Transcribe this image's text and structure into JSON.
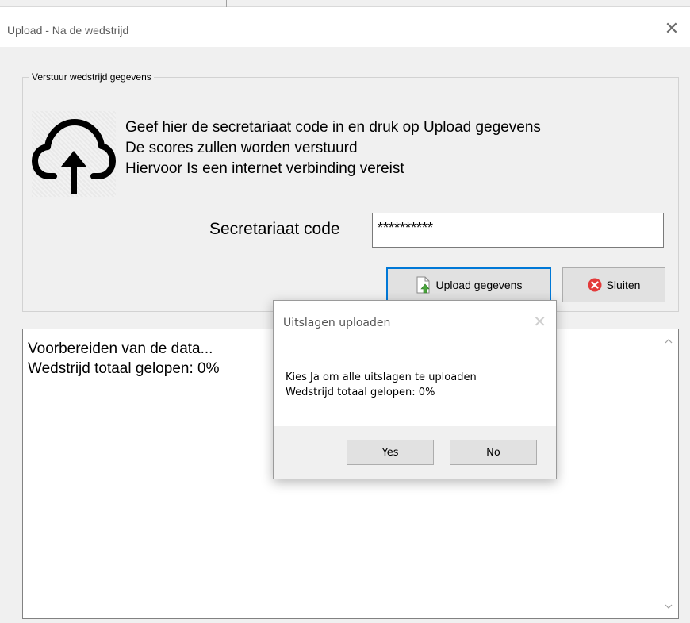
{
  "window": {
    "title": "Upload - Na de wedstrijd",
    "close_glyph": "✕"
  },
  "group": {
    "legend": "Verstuur wedstrijd gegevens",
    "icon": "cloud-upload-icon",
    "instructions": [
      "Geef hier de secretariaat code in en druk op Upload gegevens",
      "De scores zullen worden verstuurd",
      "Hiervoor Is een internet verbinding vereist"
    ],
    "code_label": "Secretariaat code",
    "code_value": "**********",
    "upload_label": "Upload gegevens",
    "upload_icon": "document-upload-icon",
    "close_label": "Sluiten",
    "close_icon": "red-x-circle-icon"
  },
  "log": {
    "lines": [
      "Voorbereiden van de data...",
      "Wedstrijd totaal gelopen: 0%"
    ]
  },
  "dialog": {
    "title": "Uitslagen uploaden",
    "close_glyph": "✕",
    "message": [
      "Kies Ja om alle uitslagen te uploaden",
      "Wedstrijd totaal gelopen: 0%"
    ],
    "yes_label": "Yes",
    "no_label": "No"
  },
  "colors": {
    "focus_border": "#0078d7",
    "close_icon_red": "#e33b3b",
    "window_bg": "#f0f0f0"
  }
}
